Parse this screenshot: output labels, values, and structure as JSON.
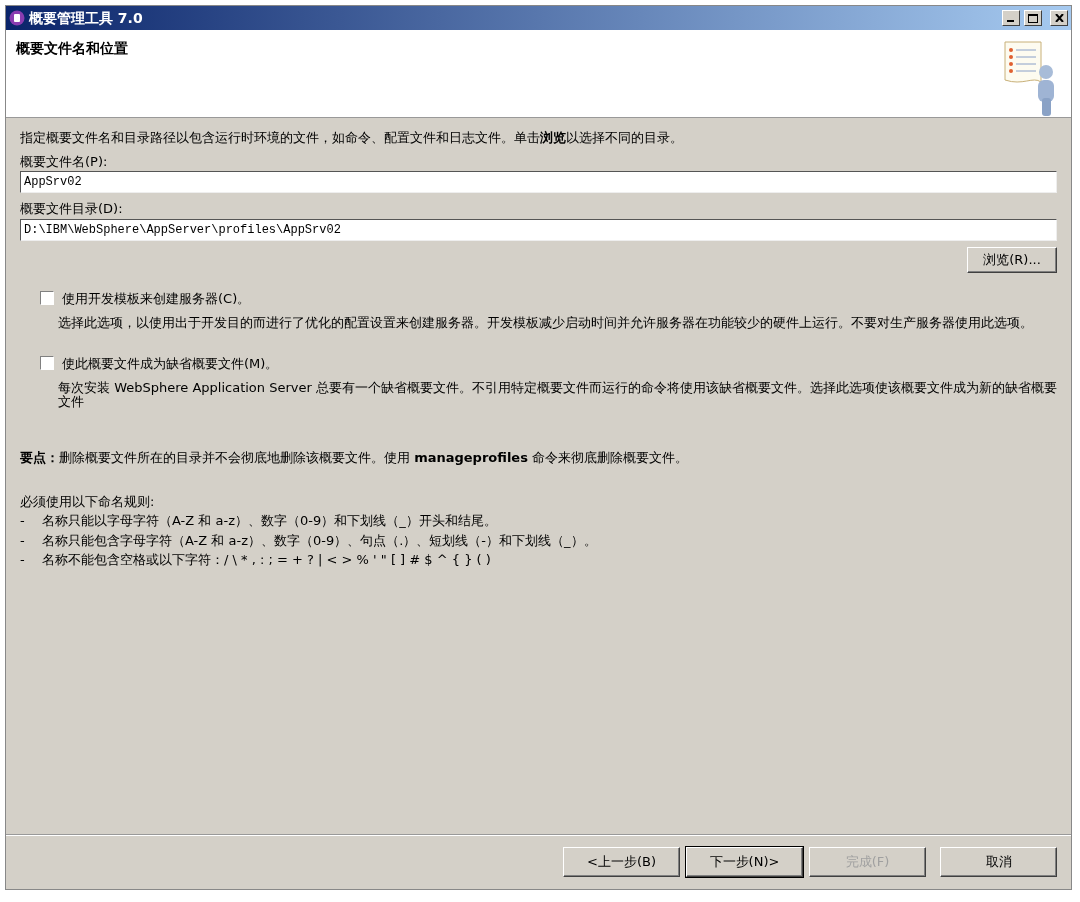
{
  "window": {
    "title": "概要管理工具 7.0"
  },
  "header": {
    "title": "概要文件名和位置"
  },
  "instruction": "指定概要文件名和目录路径以包含运行时环境的文件，如命令、配置文件和日志文件。单击**浏览**以选择不同的目录。",
  "fields": [
    {
      "label": "概要文件名(P):",
      "value": "AppSrv02"
    },
    {
      "label": "概要文件目录(D):",
      "value": "D:\\IBM\\WebSphere\\AppServer\\profiles\\AppSrv02"
    }
  ],
  "browse_button": {
    "label": "浏览(R)..."
  },
  "options": [
    {
      "label": "使用开发模板来创建服务器(C)。",
      "checked": false,
      "description": "选择此选项，以使用出于开发目的而进行了优化的配置设置来创建服务器。开发模板减少启动时间并允许服务器在功能较少的硬件上运行。不要对生产服务器使用此选项。"
    },
    {
      "label": "使此概要文件成为缺省概要文件(M)。",
      "checked": false,
      "description": "每次安装 WebSphere Application Server 总要有一个缺省概要文件。不引用特定概要文件而运行的命令将使用该缺省概要文件。选择此选项使该概要文件成为新的缺省概要文件"
    }
  ],
  "note": "**要点：**删除概要文件所在的目录并不会彻底地删除该概要文件。使用 **manageprofiles** 命令来彻底删除概要文件。",
  "rules": {
    "heading": "必须使用以下命名规则:",
    "items": [
      {
        "marker": "-",
        "text": "名称只能以字母字符（A-Z 和 a-z）、数字（0-9）和下划线（_）开头和结尾。"
      },
      {
        "marker": "-",
        "text": "名称只能包含字母字符（A-Z 和 a-z）、数字（0-9）、句点（.）、短划线（-）和下划线（_）。"
      },
      {
        "marker": "-",
        "text": "名称不能包含空格或以下字符：/ \\ * , : ; = + ? | < >  % ' \" [ ] # $ ^ { } ( )"
      }
    ]
  },
  "buttons": [
    {
      "label": "<上一步(B)",
      "disabled": false,
      "default": false
    },
    {
      "label": "下一步(N)>",
      "disabled": false,
      "default": true
    },
    {
      "label": "完成(F)",
      "disabled": true,
      "default": false
    },
    {
      "label": "取消",
      "disabled": false,
      "default": false
    }
  ]
}
